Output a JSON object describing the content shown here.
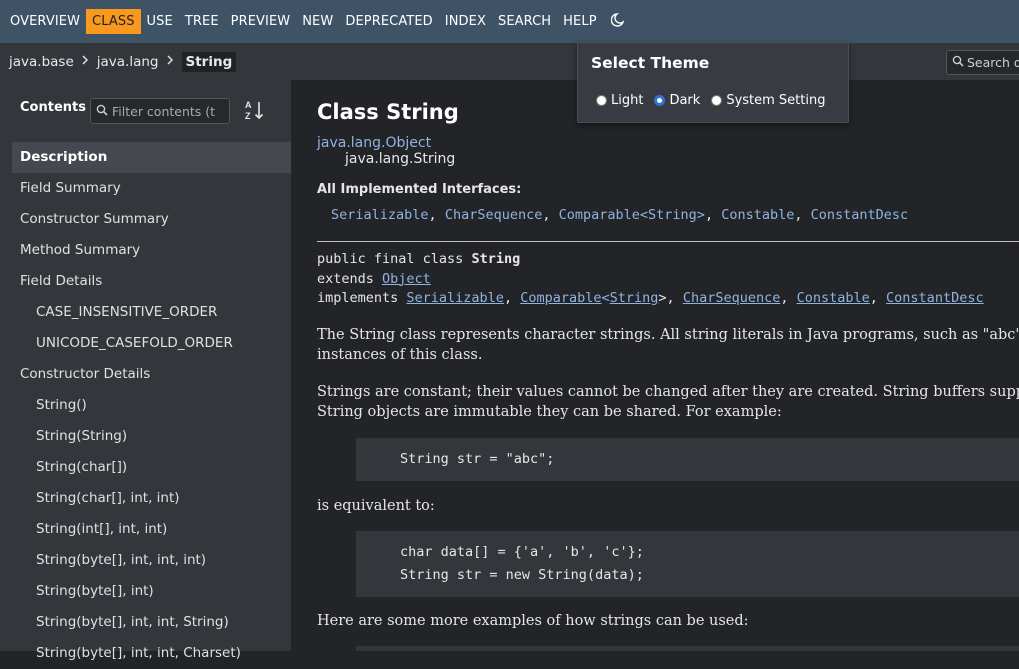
{
  "topnav": {
    "items": [
      {
        "label": "OVERVIEW",
        "active": false
      },
      {
        "label": "CLASS",
        "active": true
      },
      {
        "label": "USE",
        "active": false
      },
      {
        "label": "TREE",
        "active": false
      },
      {
        "label": "PREVIEW",
        "active": false
      },
      {
        "label": "NEW",
        "active": false
      },
      {
        "label": "DEPRECATED",
        "active": false
      },
      {
        "label": "INDEX",
        "active": false
      },
      {
        "label": "SEARCH",
        "active": false
      },
      {
        "label": "HELP",
        "active": false
      }
    ],
    "theme_icon": "moon-icon",
    "active_color": "#f8981d"
  },
  "breadcrumb": {
    "module": "java.base",
    "package": "java.lang",
    "current": "String",
    "separator": "›"
  },
  "search": {
    "placeholder": "Search d"
  },
  "sidebar": {
    "contents_label": "Contents",
    "filter_placeholder": "Filter contents (t",
    "items": [
      {
        "label": "Description",
        "level": 0,
        "selected": true
      },
      {
        "label": "Field Summary",
        "level": 0
      },
      {
        "label": "Constructor Summary",
        "level": 0
      },
      {
        "label": "Method Summary",
        "level": 0
      },
      {
        "label": "Field Details",
        "level": 0
      },
      {
        "label": "CASE_INSENSITIVE_ORDER",
        "level": 1
      },
      {
        "label": "UNICODE_CASEFOLD_ORDER",
        "level": 1
      },
      {
        "label": "Constructor Details",
        "level": 0
      },
      {
        "label": "String()",
        "level": 1
      },
      {
        "label": "String(String)",
        "level": 1
      },
      {
        "label": "String(char[])",
        "level": 1
      },
      {
        "label": "String(char[], int, int)",
        "level": 1
      },
      {
        "label": "String(int[], int, int)",
        "level": 1
      },
      {
        "label": "String(byte[], int, int, int)",
        "level": 1
      },
      {
        "label": "String(byte[], int)",
        "level": 1
      },
      {
        "label": "String(byte[], int, int, String)",
        "level": 1
      },
      {
        "label": "String(byte[], int, int, Charset)",
        "level": 1
      }
    ]
  },
  "main": {
    "title": "Class String",
    "inheritance": [
      "java.lang.Object",
      "java.lang.String"
    ],
    "implemented_label": "All Implemented Interfaces:",
    "interfaces": [
      "Serializable",
      "CharSequence",
      "Comparable<String>",
      "Constable",
      "ConstantDesc"
    ],
    "signature": {
      "line1_prefix": "public final class ",
      "class_name": "String",
      "extends_kw": "extends ",
      "extends": "Object",
      "implements_kw": "implements "
    },
    "para1_line1": "The String class represents character strings. All string literals in Java programs, such as \"abc\"",
    "para1_line2": "instances of this class.",
    "para2_line1": "Strings are constant; their values cannot be changed after they are created. String buffers supp",
    "para2_line2": "String objects are immutable they can be shared. For example:",
    "code1": "String str = \"abc\";",
    "para3": "is equivalent to:",
    "code2_line1": "char data[] = {'a', 'b', 'c'};",
    "code2_line2": "String str = new String(data);",
    "para4": "Here are some more examples of how strings can be used:"
  },
  "theme_popup": {
    "title": "Select Theme",
    "options": [
      {
        "label": "Light",
        "checked": false
      },
      {
        "label": "Dark",
        "checked": true
      },
      {
        "label": "System Setting",
        "checked": false
      }
    ],
    "accent": "#2f76d2"
  }
}
